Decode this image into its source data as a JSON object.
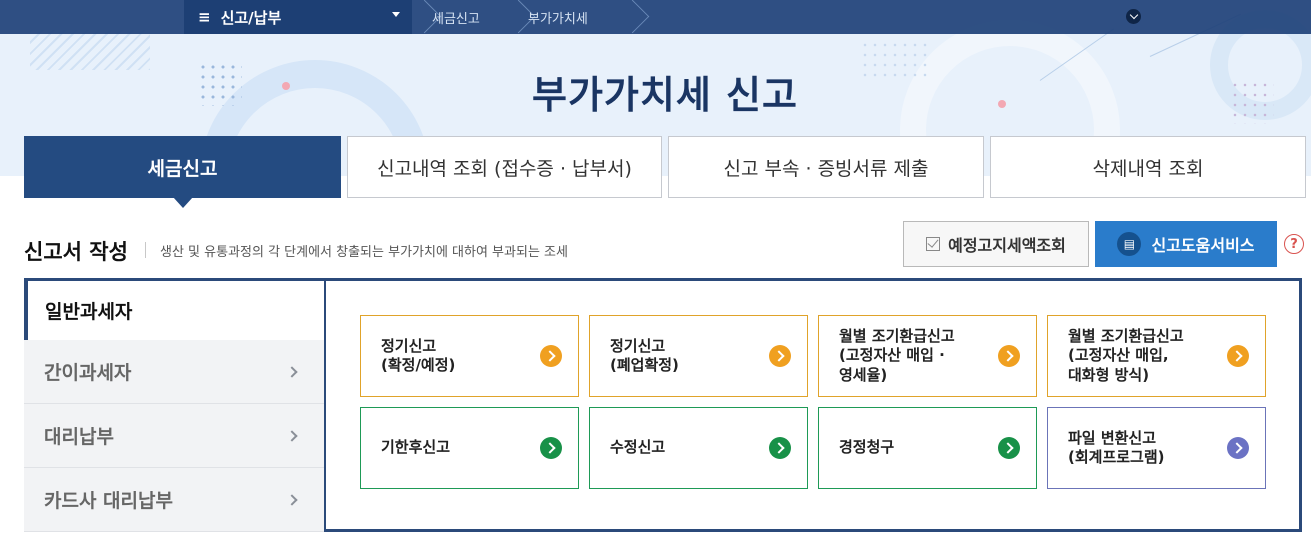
{
  "nav": {
    "menu_label": "신고/납부",
    "breadcrumb": [
      "세금신고",
      "부가가치세"
    ]
  },
  "page_title": "부가가치세 신고",
  "tabs": [
    {
      "label": "세금신고",
      "active": true
    },
    {
      "label": "신고내역 조회 (접수증 · 납부서)",
      "active": false
    },
    {
      "label": "신고 부속 · 증빙서류 제출",
      "active": false
    },
    {
      "label": "삭제내역 조회",
      "active": false
    }
  ],
  "section": {
    "title": "신고서 작성",
    "description": "생산 및 유통과정의 각 단계에서 창출되는 부가가치에 대하여 부과되는 조세",
    "notice_button": "예정고지세액조회",
    "help_button": "신고도움서비스",
    "help_icon": "?"
  },
  "categories": [
    {
      "label": "일반과세자",
      "active": true
    },
    {
      "label": "간이과세자",
      "active": false
    },
    {
      "label": "대리납부",
      "active": false
    },
    {
      "label": "카드사 대리납부",
      "active": false
    }
  ],
  "cards": [
    {
      "label": "정기신고\n(확정/예정)",
      "color": "#f0a020"
    },
    {
      "label": "정기신고\n(폐업확정)",
      "color": "#f0a020"
    },
    {
      "label": "월별 조기환급신고\n(고정자산 매입 ·\n영세율)",
      "color": "#f0a020"
    },
    {
      "label": "월별 조기환급신고\n(고정자산 매입,\n대화형 방식)",
      "color": "#f0a020"
    },
    {
      "label": "기한후신고",
      "color": "#189148"
    },
    {
      "label": "수정신고",
      "color": "#189148"
    },
    {
      "label": "경정청구",
      "color": "#189148"
    },
    {
      "label": "파일 변환신고\n(회계프로그램)",
      "color": "#6b72c4"
    }
  ],
  "colors": {
    "primary": "#244b81",
    "help_button": "#2a7ccb",
    "orange": "#f0a020",
    "green": "#189148",
    "purple": "#6b72c4"
  }
}
